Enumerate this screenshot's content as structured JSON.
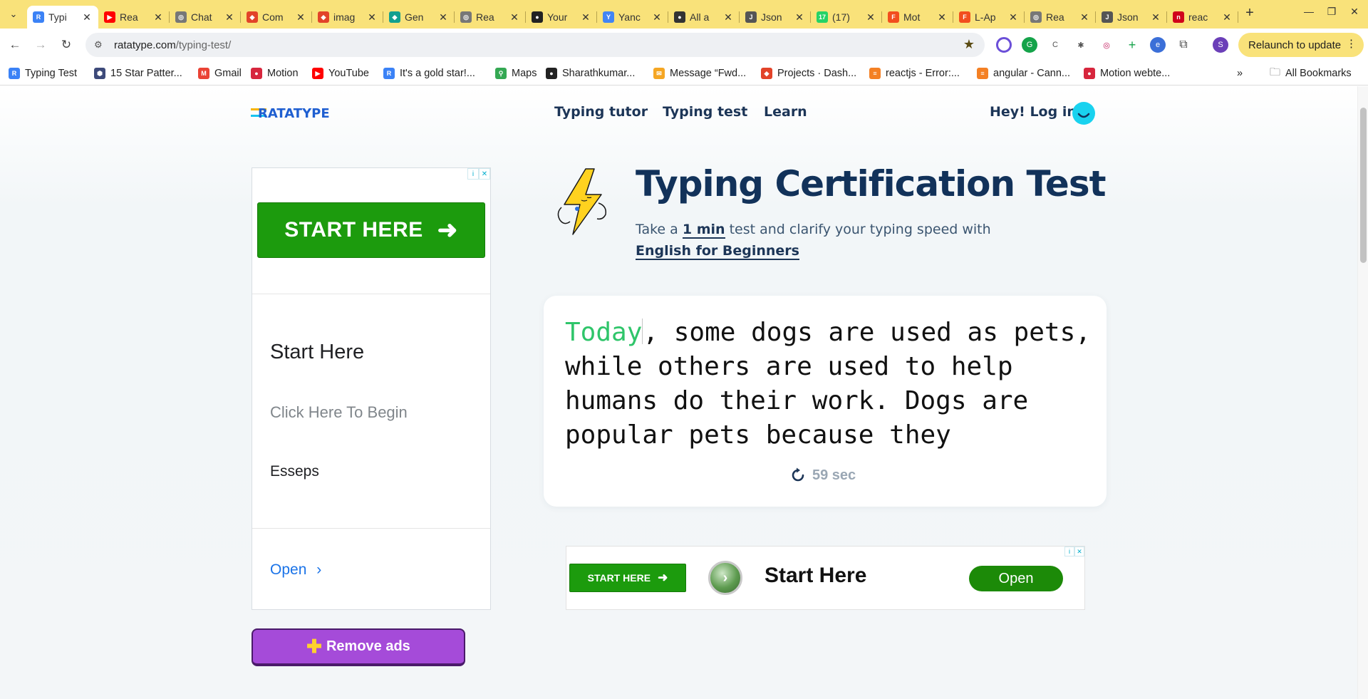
{
  "browser": {
    "tabs": [
      {
        "title": "Typi",
        "fav_color": "#3b82f6",
        "fav_text": "R"
      },
      {
        "title": "Rea",
        "fav_color": "#ff0000",
        "fav_text": "▶"
      },
      {
        "title": "Chat",
        "fav_color": "#777777",
        "fav_text": "◎"
      },
      {
        "title": "Com",
        "fav_color": "#e24329",
        "fav_text": "◆"
      },
      {
        "title": "imag",
        "fav_color": "#e24329",
        "fav_text": "◆"
      },
      {
        "title": "Gen",
        "fav_color": "#12a08f",
        "fav_text": "◆"
      },
      {
        "title": "Rea",
        "fav_color": "#777777",
        "fav_text": "◎"
      },
      {
        "title": "Your",
        "fav_color": "#222222",
        "fav_text": "●"
      },
      {
        "title": "Yanc",
        "fav_color": "#4285f4",
        "fav_text": "Y"
      },
      {
        "title": "All a",
        "fav_color": "#333333",
        "fav_text": "●"
      },
      {
        "title": "Json",
        "fav_color": "#555555",
        "fav_text": "J"
      },
      {
        "title": "(17)",
        "fav_color": "#25d366",
        "fav_text": "17"
      },
      {
        "title": "Mot",
        "fav_color": "#f24e1e",
        "fav_text": "F"
      },
      {
        "title": "L-Ap",
        "fav_color": "#f24e1e",
        "fav_text": "F"
      },
      {
        "title": "Rea",
        "fav_color": "#777777",
        "fav_text": "◎"
      },
      {
        "title": "Json",
        "fav_color": "#555555",
        "fav_text": "J"
      },
      {
        "title": "reac",
        "fav_color": "#d0021b",
        "fav_text": "n"
      }
    ],
    "url_host": "ratatype.com",
    "url_path": "/typing-test/",
    "relaunch_label": "Relaunch to update",
    "profile_initial": "S",
    "bookmarks": [
      {
        "label": "Typing Test",
        "color": "#3b82f6",
        "icon": "R"
      },
      {
        "label": "15 Star Patter...",
        "color": "#3d4a7a",
        "icon": "⬢"
      },
      {
        "label": "Gmail",
        "color": "#ea4335",
        "icon": "M"
      },
      {
        "label": "Motion",
        "color": "#d7263d",
        "icon": "●"
      },
      {
        "label": "YouTube",
        "color": "#ff0000",
        "icon": "▶"
      },
      {
        "label": "It's a gold star!...",
        "color": "#3b82f6",
        "icon": "R"
      },
      {
        "label": "Maps",
        "color": "#34a853",
        "icon": "⚲"
      },
      {
        "label": "Sharathkumar...",
        "color": "#222222",
        "icon": "●"
      },
      {
        "label": "Message “Fwd...",
        "color": "#f5a623",
        "icon": "✉"
      },
      {
        "label": "Projects · Dash...",
        "color": "#e24329",
        "icon": "◆"
      },
      {
        "label": "reactjs - Error:...",
        "color": "#f48024",
        "icon": "≡"
      },
      {
        "label": "angular - Cann...",
        "color": "#f48024",
        "icon": "≡"
      },
      {
        "label": "Motion webte...",
        "color": "#d7263d",
        "icon": "●"
      }
    ],
    "all_bookmarks_label": "All Bookmarks"
  },
  "site": {
    "logo": "RATATYPE",
    "nav": [
      "Typing tutor",
      "Typing test",
      "Learn"
    ],
    "login": "Hey! Log in"
  },
  "hero": {
    "title": "Typing Certification Test",
    "lead_prefix": "Take a",
    "lead_duration": "1 min",
    "lead_middle": "test and clarify your typing speed with",
    "lead_course": "English for Beginners"
  },
  "typing": {
    "typed": "Today",
    "remaining": ", some dogs are used as pets, while others are used to help humans do their work. Dogs are popular pets because they",
    "timer": "59 sec"
  },
  "side_ad": {
    "cta": "START HERE",
    "title": "Start Here",
    "subtitle": "Click Here To Begin",
    "brand": "Esseps",
    "open": "Open"
  },
  "bottom_ad": {
    "cta": "START HERE",
    "title": "Start Here",
    "open": "Open"
  },
  "remove_ads": "Remove ads"
}
